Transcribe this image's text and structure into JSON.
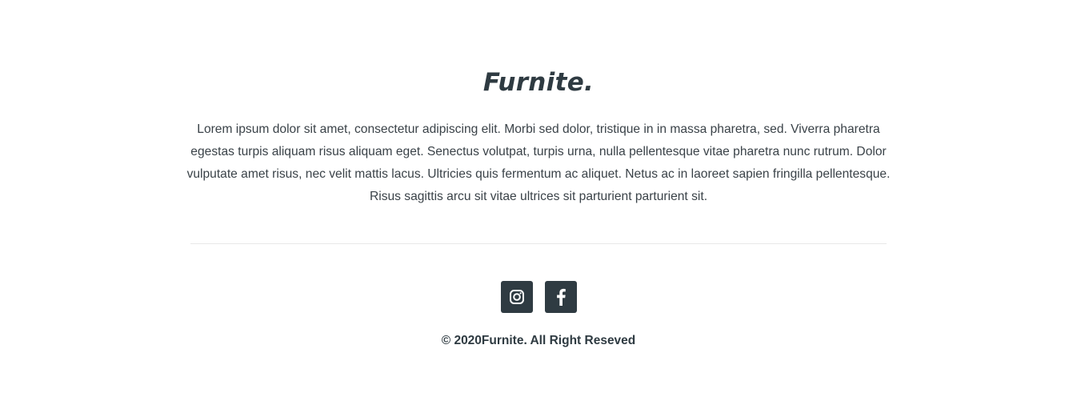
{
  "footer": {
    "brand": "Furnite.",
    "description": "Lorem ipsum dolor sit amet, consectetur adipiscing elit. Morbi sed dolor, tristique in in massa pharetra, sed. Viverra pharetra egestas turpis aliquam risus aliquam eget. Senectus volutpat, turpis urna, nulla pellentesque vitae pharetra nunc rutrum. Dolor vulputate amet risus, nec velit mattis lacus. Ultricies quis fermentum ac aliquet. Netus ac in laoreet sapien fringilla pellentesque. Risus sagittis arcu sit vitae ultrices sit parturient parturient sit.",
    "social": [
      {
        "icon": "instagram-icon"
      },
      {
        "icon": "facebook-icon"
      }
    ],
    "copyright": "© 2020Furnite. All Right Reseved"
  },
  "colors": {
    "text": "#2f3b42",
    "icon_bg": "#2f3b42",
    "divider": "#e8e8e8",
    "background": "#ffffff"
  }
}
